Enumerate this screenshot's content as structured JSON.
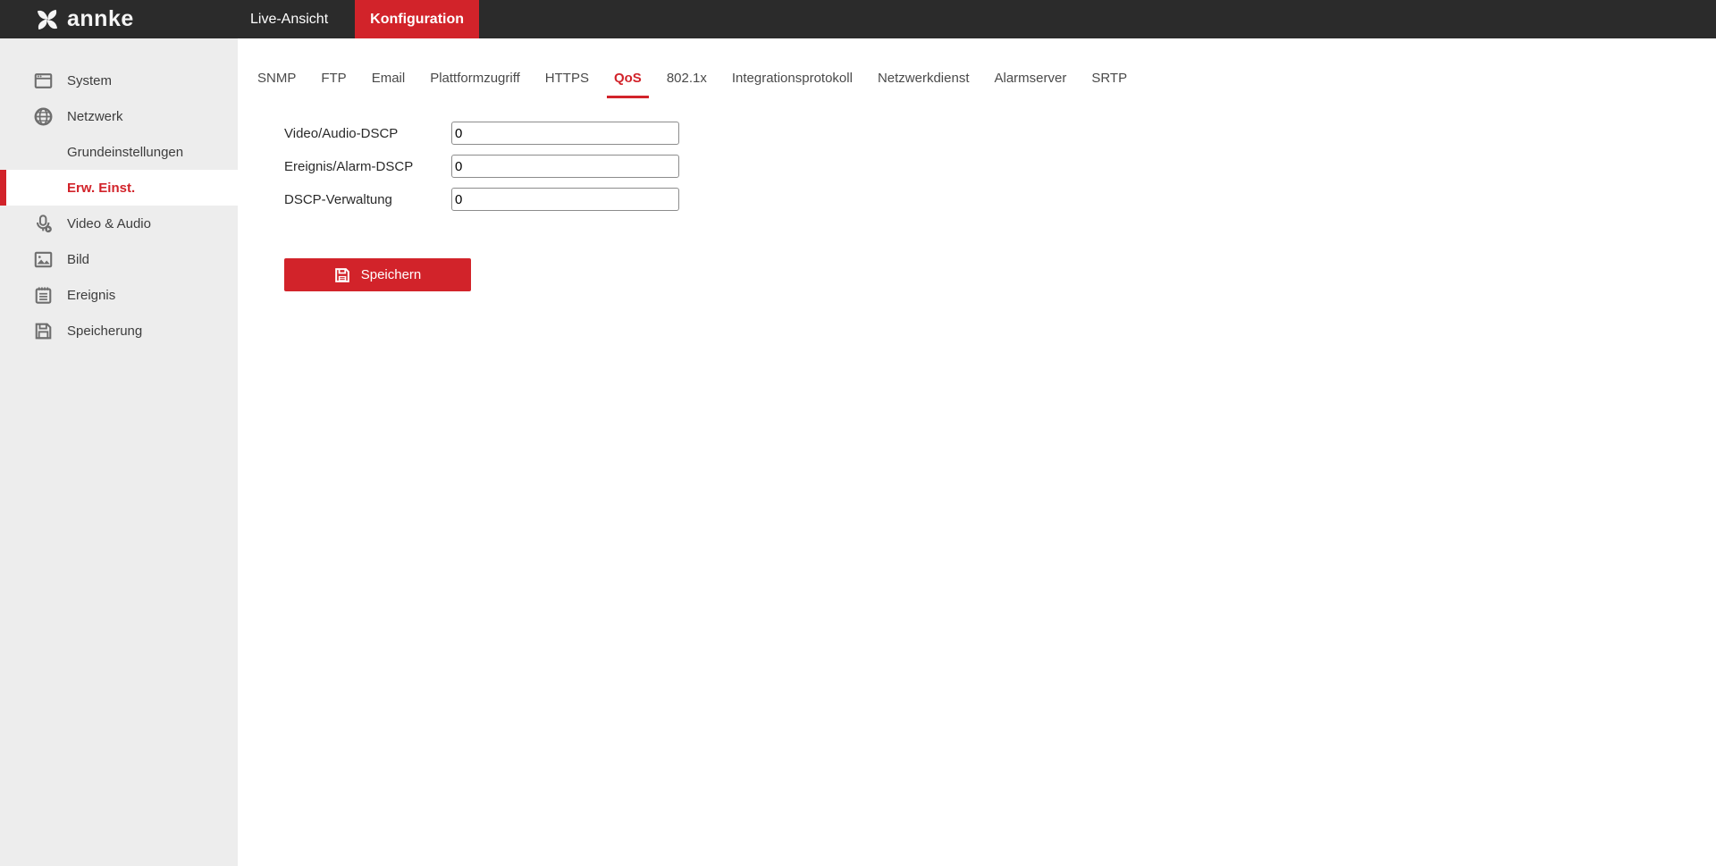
{
  "topbar": {
    "logo_text": "annke",
    "nav": [
      {
        "label": "Live-Ansicht",
        "active": false
      },
      {
        "label": "Konfiguration",
        "active": true
      }
    ]
  },
  "sidebar": {
    "items": [
      {
        "label": "System",
        "icon": "window-icon",
        "sub": false,
        "active": false
      },
      {
        "label": "Netzwerk",
        "icon": "globe-icon",
        "sub": false,
        "active": false
      },
      {
        "label": "Grundeinstellungen",
        "icon": null,
        "sub": true,
        "active": false
      },
      {
        "label": "Erw. Einst.",
        "icon": null,
        "sub": true,
        "active": true
      },
      {
        "label": "Video & Audio",
        "icon": "microphone-icon",
        "sub": false,
        "active": false
      },
      {
        "label": "Bild",
        "icon": "image-icon",
        "sub": false,
        "active": false
      },
      {
        "label": "Ereignis",
        "icon": "event-notepad-icon",
        "sub": false,
        "active": false
      },
      {
        "label": "Speicherung",
        "icon": "floppy-disk-icon",
        "sub": false,
        "active": false
      }
    ]
  },
  "tabs": [
    "SNMP",
    "FTP",
    "Email",
    "Plattformzugriff",
    "HTTPS",
    "QoS",
    "802.1x",
    "Integrationsprotokoll",
    "Netzwerkdienst",
    "Alarmserver",
    "SRTP"
  ],
  "active_tab": "QoS",
  "form": {
    "fields": [
      {
        "label": "Video/Audio-DSCP",
        "value": "0"
      },
      {
        "label": "Ereignis/Alarm-DSCP",
        "value": "0"
      },
      {
        "label": "DSCP-Verwaltung",
        "value": "0"
      }
    ],
    "save_label": "Speichern"
  },
  "colors": {
    "accent": "#d2232a",
    "topbar_bg": "#2b2b2b",
    "sidebar_bg": "#ededed"
  }
}
